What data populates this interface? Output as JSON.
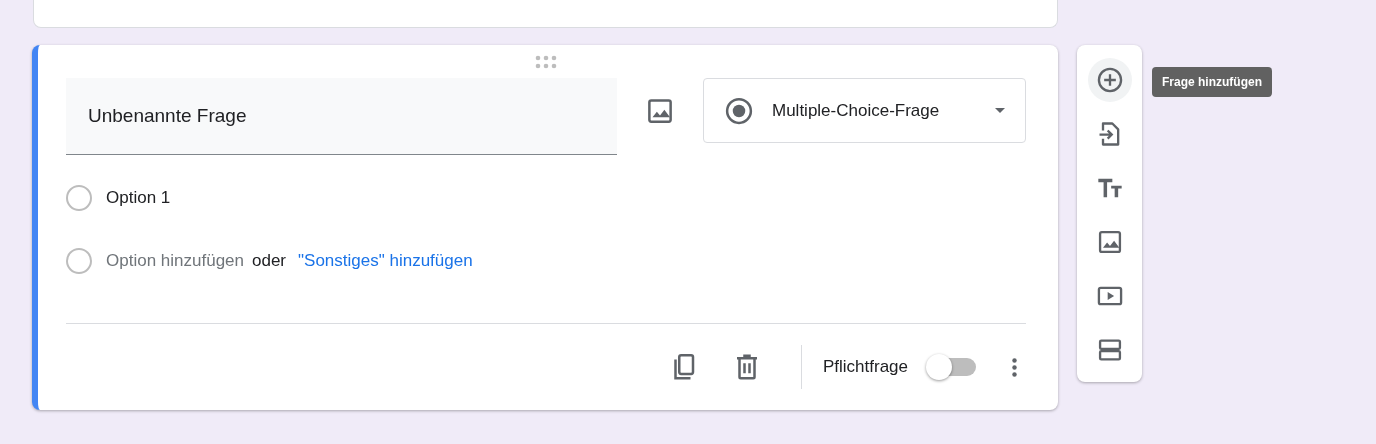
{
  "question": {
    "focused": true,
    "title": "Unbenannte Frage",
    "type_label": "Multiple-Choice-Frage",
    "options": [
      {
        "label": "Option 1"
      }
    ],
    "add_option": "Option hinzufügen",
    "or": "oder",
    "add_other": "\"Sonstiges\" hinzufügen",
    "required_label": "Pflichtfrage",
    "required": false
  },
  "sidebar": {
    "tooltip": "Frage hinzufügen",
    "items": [
      {
        "kind": "add-question",
        "hovered": true
      },
      {
        "kind": "import",
        "hovered": false
      },
      {
        "kind": "title",
        "hovered": false
      },
      {
        "kind": "image",
        "hovered": false
      },
      {
        "kind": "video",
        "hovered": false
      },
      {
        "kind": "section",
        "hovered": false
      }
    ]
  }
}
